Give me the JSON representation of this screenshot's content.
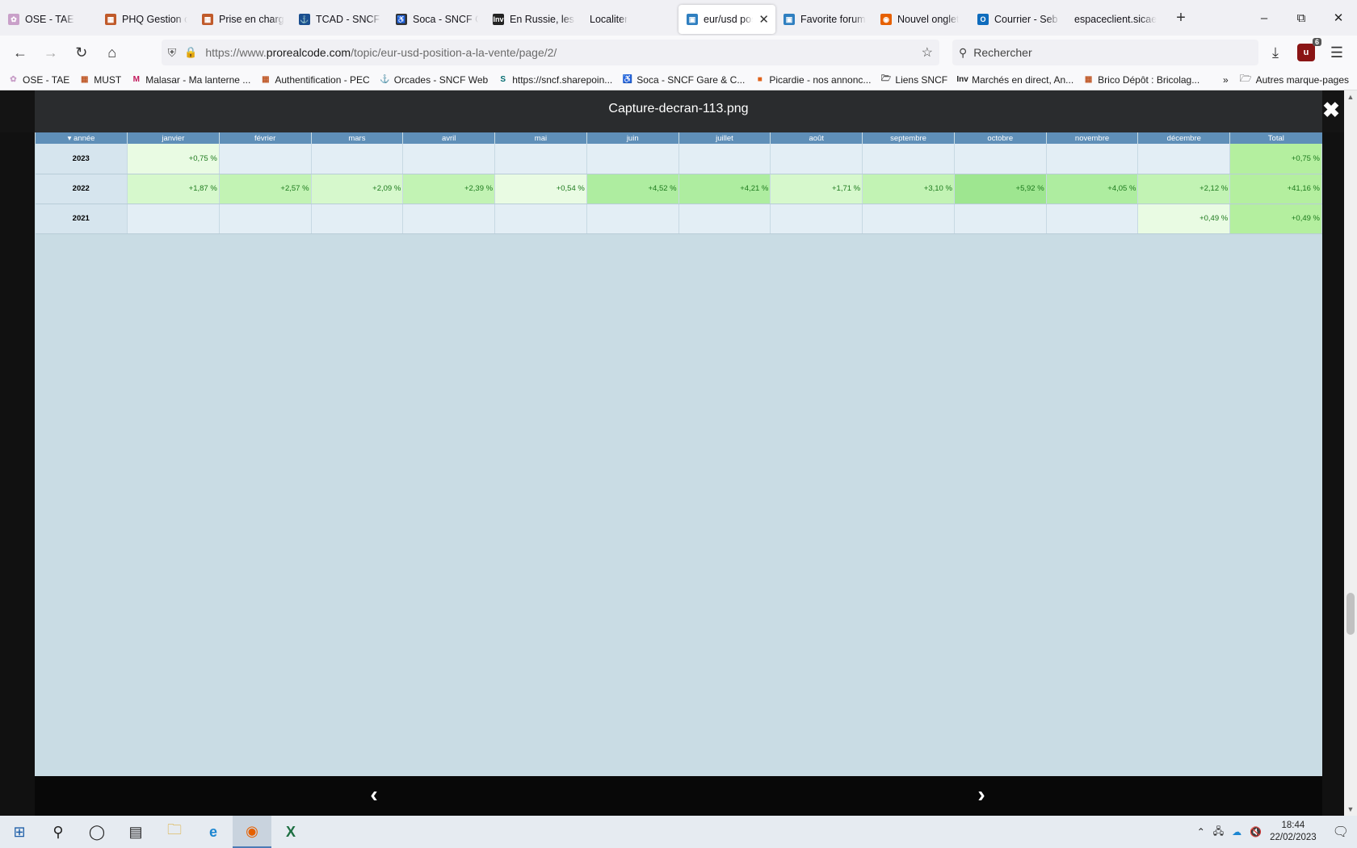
{
  "tabs": [
    {
      "label": "OSE - TAE",
      "icon": "flower-icon",
      "active": false
    },
    {
      "label": "PHQ Gestion o",
      "icon": "grid-icon",
      "active": false
    },
    {
      "label": "Prise en charge",
      "icon": "grid-icon",
      "active": false
    },
    {
      "label": "TCAD - SNCF V",
      "icon": "anchor-icon",
      "active": false
    },
    {
      "label": "Soca - SNCF G",
      "icon": "accessibility-icon",
      "active": false
    },
    {
      "label": "En Russie, les g",
      "icon": "inv-icon",
      "active": false
    },
    {
      "label": "Localiter",
      "icon": "",
      "active": false
    },
    {
      "label": "eur/usd posi",
      "icon": "forum-icon",
      "active": true
    },
    {
      "label": "Favorite forum",
      "icon": "forum-icon",
      "active": false
    },
    {
      "label": "Nouvel onglet",
      "icon": "firefox-icon",
      "active": false
    },
    {
      "label": "Courrier - Seb I",
      "icon": "outlook-icon",
      "active": false
    },
    {
      "label": "espaceclient.sicae-",
      "icon": "",
      "active": false
    }
  ],
  "nav": {
    "url_prefix": "https://www.",
    "url_host": "prorealcode.com",
    "url_path": "/topic/eur-usd-position-a-la-vente/page/2/",
    "search_placeholder": "Rechercher",
    "ublock_badge": "6"
  },
  "bookmarks": [
    {
      "label": "OSE - TAE",
      "icon": "flower-icon"
    },
    {
      "label": "MUST",
      "icon": "grid-icon"
    },
    {
      "label": "Malasar - Ma lanterne ...",
      "icon": "m-logo-icon"
    },
    {
      "label": "Authentification - PEC",
      "icon": "grid-icon"
    },
    {
      "label": "Orcades - SNCF Web",
      "icon": "anchor-icon"
    },
    {
      "label": "https://sncf.sharepoin...",
      "icon": "sharepoint-icon"
    },
    {
      "label": "Soca - SNCF Gare & C...",
      "icon": "accessibility-icon"
    },
    {
      "label": "Picardie - nos annonc...",
      "icon": "picardie-icon"
    },
    {
      "label": "Liens SNCF",
      "icon": "folder-icon"
    },
    {
      "label": "Marchés en direct, An...",
      "icon": "inv-icon"
    },
    {
      "label": "Brico Dépôt : Bricolag...",
      "icon": "grid-icon"
    }
  ],
  "bookmarks_other": "Autres marque-pages",
  "lightbox": {
    "title": "Capture-decran-113.png"
  },
  "perf_table": {
    "headers": [
      "année",
      "janvier",
      "février",
      "mars",
      "avril",
      "mai",
      "juin",
      "juillet",
      "août",
      "septembre",
      "octobre",
      "novembre",
      "décembre",
      "Total"
    ],
    "rows": [
      {
        "year": "2023",
        "cells": [
          "+0,75 %",
          "",
          "",
          "",
          "",
          "",
          "",
          "",
          "",
          "",
          "",
          ""
        ],
        "levels": [
          1,
          0,
          0,
          0,
          0,
          0,
          0,
          0,
          0,
          0,
          0,
          0
        ],
        "total": "+0,75 %"
      },
      {
        "year": "2022",
        "cells": [
          "+1,87 %",
          "+2,57 %",
          "+2,09 %",
          "+2,39 %",
          "+0,54 %",
          "+4,52 %",
          "+4,21 %",
          "+1,71 %",
          "+3,10 %",
          "+5,92 %",
          "+4,05 %",
          "+2,12 %"
        ],
        "levels": [
          2,
          3,
          2,
          3,
          1,
          4,
          4,
          2,
          3,
          5,
          4,
          3
        ],
        "total": "+41,16 %"
      },
      {
        "year": "2021",
        "cells": [
          "",
          "",
          "",
          "",
          "",
          "",
          "",
          "",
          "",
          "",
          "",
          "+0,49 %"
        ],
        "levels": [
          0,
          0,
          0,
          0,
          0,
          0,
          0,
          0,
          0,
          0,
          0,
          1
        ],
        "total": "+0,49 %"
      }
    ]
  },
  "taskbar": {
    "time": "18:44",
    "date": "22/02/2023"
  }
}
